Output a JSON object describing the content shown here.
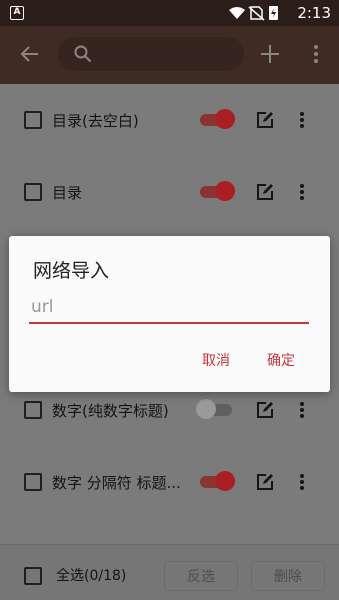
{
  "status_bar": {
    "notification_letter": "A",
    "time": "2:13"
  },
  "toolbar": {
    "search": {
      "value": "",
      "placeholder": ""
    }
  },
  "list": {
    "rows": [
      {
        "label": "目录(去空白)",
        "enabled": true
      },
      {
        "label": "目录",
        "enabled": true
      },
      {
        "label": "",
        "enabled": true
      },
      {
        "label": "",
        "enabled": true
      },
      {
        "label": "数字(纯数字标题)",
        "enabled": false
      },
      {
        "label": "数字 分隔符 标题...",
        "enabled": true
      }
    ]
  },
  "bottom_bar": {
    "select_all_label": "全选(0/18)",
    "invert_label": "反选",
    "delete_label": "删除"
  },
  "dialog": {
    "title": "网络导入",
    "input": {
      "value": "",
      "placeholder": "url"
    },
    "cancel_label": "取消",
    "ok_label": "确定"
  },
  "colors": {
    "accent": "#c8373d",
    "toolbar": "#3e2b23",
    "status_bar": "#2b1d17",
    "switch_on": "#a81f24"
  }
}
